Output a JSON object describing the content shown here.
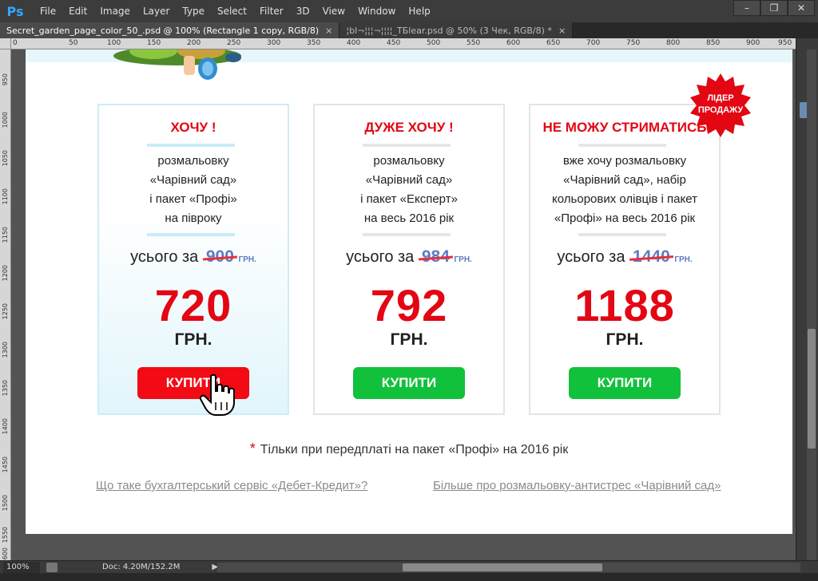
{
  "app": {
    "logo": "Ps",
    "menu": [
      "File",
      "Edit",
      "Image",
      "Layer",
      "Type",
      "Select",
      "Filter",
      "3D",
      "View",
      "Window",
      "Help"
    ],
    "window_buttons": {
      "minimize": "–",
      "restore": "❐",
      "close": "✕"
    }
  },
  "tabs": [
    {
      "label": "Secret_garden_page_color_50_.psd @ 100% (Rectangle 1 copy, RGB/8)",
      "close": "×"
    },
    {
      "label": "¦bl¬¦¦¦¬¦¦¦¦_TБlear.psd @ 50% (3 Чек, RGB/8) *",
      "close": "×"
    }
  ],
  "ruler": {
    "top": [
      "0",
      "50",
      "100",
      "150",
      "200",
      "250",
      "300",
      "350",
      "400",
      "450",
      "500",
      "550",
      "600",
      "650",
      "700",
      "750",
      "800",
      "850",
      "900",
      "950"
    ],
    "left": [
      "950",
      "1000",
      "1050",
      "1100",
      "1150",
      "1200",
      "1250",
      "1300",
      "1350",
      "1400",
      "1450",
      "1500",
      "1550",
      "1600"
    ]
  },
  "cards": [
    {
      "title": "ХОЧУ !",
      "description": "розмальовку\n«Чарівний сад»\nі пакет «Профі»\nна півроку",
      "price_prefix": "усього за",
      "old_price": "900",
      "old_currency": "ГРН.",
      "new_price": "720",
      "new_currency": "ГРН.",
      "button": "КУПИТИ"
    },
    {
      "title": "ДУЖЕ ХОЧУ !",
      "description": "розмальовку\n«Чарівний сад»\nі пакет «Експерт»\nна весь 2016 рік",
      "price_prefix": "усього за",
      "old_price": "984",
      "old_currency": "ГРН.",
      "new_price": "792",
      "new_currency": "ГРН.",
      "button": "КУПИТИ"
    },
    {
      "title": "НЕ МОЖУ СТРИМАТИСЬ",
      "description": "вже хочу розмальовку\n«Чарівний сад», набір\nкольорових олівців і пакет\n«Профі» на весь 2016 рік",
      "price_prefix": "усього за",
      "old_price": "1440",
      "old_currency": "ГРН.",
      "new_price": "1188",
      "new_currency": "ГРН.",
      "button": "КУПИТИ"
    }
  ],
  "badge": {
    "line1": "ЛІДЕР",
    "line2": "ПРОДАЖУ"
  },
  "footnote": {
    "star": "*",
    "text": "Тільки при передплаті на пакет «Профі» на 2016 рік"
  },
  "links": {
    "left": "Що таке бухгалтерський сервіс «Дебет-Кредит»?",
    "right": "Більше про розмальовку-антистрес «Чарівний сад»"
  },
  "status": {
    "zoom": "100%",
    "doc": "Doc: 4.20M/152.2M",
    "arrow": "▶"
  },
  "colors": {
    "accent_red": "#e30613",
    "buy_red": "#f20a14",
    "buy_green": "#11c13b",
    "old_price_blue": "#5b7cc4"
  }
}
